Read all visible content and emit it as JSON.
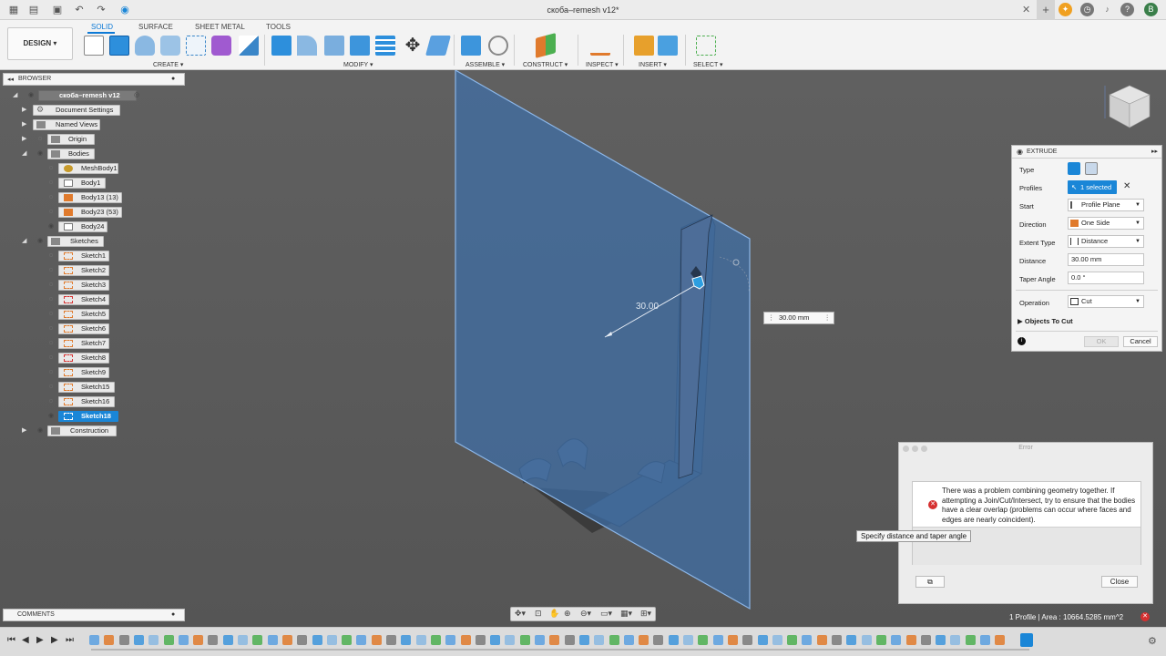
{
  "titlebar": {
    "doc_title": "скоба–remesh v12*",
    "close_tab": "✕",
    "new_tab": "+",
    "user_initial": "B"
  },
  "ribbon": {
    "design_label": "DESIGN ▾",
    "tabs": [
      "SOLID",
      "SURFACE",
      "SHEET METAL",
      "TOOLS"
    ],
    "groups": [
      "CREATE ▾",
      "MODIFY ▾",
      "ASSEMBLE ▾",
      "CONSTRUCT ▾",
      "INSPECT ▾",
      "INSERT ▾",
      "SELECT ▾"
    ]
  },
  "browser": {
    "title": "BROWSER",
    "root": "скоба–remesh v12",
    "items": [
      {
        "label": "Document Settings"
      },
      {
        "label": "Named Views"
      },
      {
        "label": "Origin"
      },
      {
        "label": "Bodies"
      },
      {
        "label": "MeshBody1"
      },
      {
        "label": "Body1"
      },
      {
        "label": "Body13 (13)"
      },
      {
        "label": "Body23 (53)"
      },
      {
        "label": "Body24"
      },
      {
        "label": "Sketches"
      },
      {
        "label": "Sketch1"
      },
      {
        "label": "Sketch2"
      },
      {
        "label": "Sketch3"
      },
      {
        "label": "Sketch4"
      },
      {
        "label": "Sketch5"
      },
      {
        "label": "Sketch6"
      },
      {
        "label": "Sketch7"
      },
      {
        "label": "Sketch8"
      },
      {
        "label": "Sketch9"
      },
      {
        "label": "Sketch15"
      },
      {
        "label": "Sketch16"
      },
      {
        "label": "Sketch18"
      },
      {
        "label": "Construction"
      }
    ]
  },
  "comments": {
    "title": "COMMENTS"
  },
  "viewport": {
    "dimension_label": "30.00",
    "dimension_input": "30.00 mm"
  },
  "extrude": {
    "title": "EXTRUDE",
    "type_label": "Type",
    "profiles_label": "Profiles",
    "profiles_value": "1 selected",
    "start_label": "Start",
    "start_value": "Profile Plane",
    "direction_label": "Direction",
    "direction_value": "One Side",
    "extent_label": "Extent Type",
    "extent_value": "Distance",
    "distance_label": "Distance",
    "distance_value": "30.00 mm",
    "taper_label": "Taper Angle",
    "taper_value": "0.0 °",
    "operation_label": "Operation",
    "operation_value": "Cut",
    "objects_label": "Objects To Cut",
    "ok_label": "OK",
    "cancel_label": "Cancel"
  },
  "error": {
    "title": "Error",
    "message": "There was a problem combining geometry together. If attempting a Join/Cut/Intersect, try to ensure that the bodies have a clear overlap (problems can occur where faces and edges are nearly coincident).",
    "close_label": "Close"
  },
  "tooltip": "Specify distance and taper angle",
  "status": "1 Profile | Area : 10664.5285 mm^2",
  "colors": {
    "accent": "#1a86d7",
    "plane": "#3f6fa8",
    "viewport_bg": "#5b5b5b",
    "error_red": "#d63030"
  }
}
